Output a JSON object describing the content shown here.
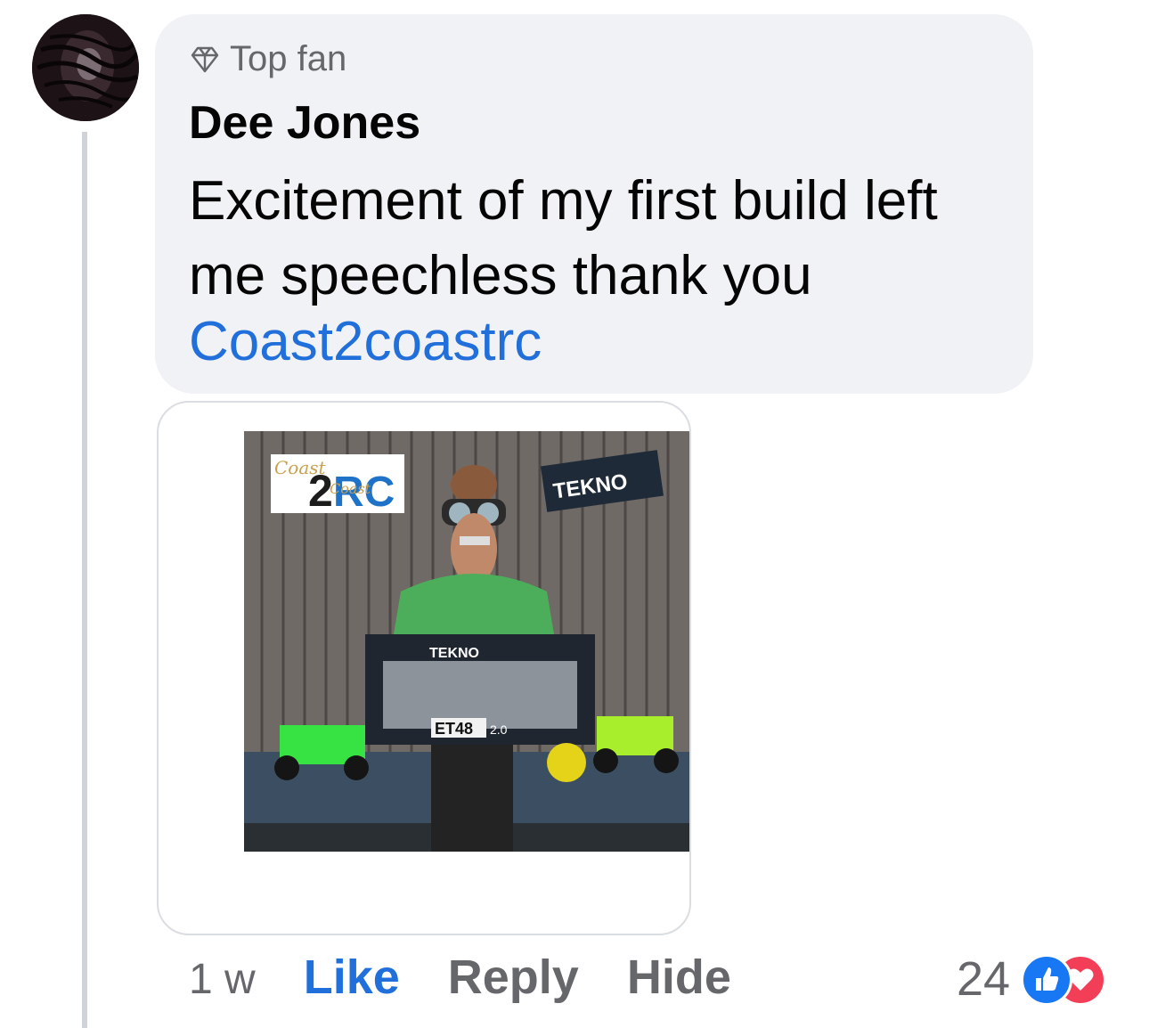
{
  "comment": {
    "badge_label": "Top fan",
    "author": "Dee Jones",
    "text": "Excitement of my first build left me speechless thank you",
    "mention": "Coast2coastrc"
  },
  "attachment": {
    "logo_left_top": "Coast",
    "logo_left_mid": "2",
    "logo_left_big": "RC",
    "logo_left_small": "Coast",
    "logo_right": "TEKNO",
    "box_brand": "TEKNO",
    "box_model": "ET48",
    "box_version": "2.0"
  },
  "actions": {
    "time": "1 w",
    "like": "Like",
    "reply": "Reply",
    "hide": "Hide"
  },
  "reactions": {
    "count": "24",
    "icons": [
      "like-icon",
      "love-icon"
    ],
    "like_color": "#1877f2",
    "love_color": "#f33e58"
  },
  "colors": {
    "bubble": "#f0f2f5",
    "link": "#216fdb",
    "secondary_text": "#65676b"
  }
}
